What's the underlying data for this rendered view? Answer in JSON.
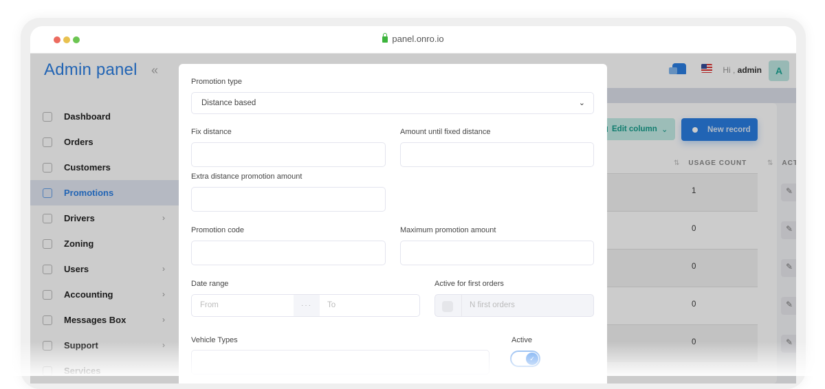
{
  "browser": {
    "url": "panel.onro.io"
  },
  "sidebar": {
    "brand": "Admin panel",
    "collapse_icon": "double-chevron-left",
    "items": [
      {
        "label": "Dashboard",
        "icon": "home-icon",
        "has_submenu": false,
        "active": false
      },
      {
        "label": "Orders",
        "icon": "orders-icon",
        "has_submenu": false,
        "active": false
      },
      {
        "label": "Customers",
        "icon": "customers-icon",
        "has_submenu": false,
        "active": false
      },
      {
        "label": "Promotions",
        "icon": "promotions-icon",
        "has_submenu": false,
        "active": true
      },
      {
        "label": "Drivers",
        "icon": "drivers-icon",
        "has_submenu": true,
        "active": false
      },
      {
        "label": "Zoning",
        "icon": "zoning-icon",
        "has_submenu": false,
        "active": false
      },
      {
        "label": "Users",
        "icon": "users-icon",
        "has_submenu": true,
        "active": false
      },
      {
        "label": "Accounting",
        "icon": "accounting-icon",
        "has_submenu": true,
        "active": false
      },
      {
        "label": "Messages Box",
        "icon": "messages-icon",
        "has_submenu": true,
        "active": false
      },
      {
        "label": "Support",
        "icon": "support-icon",
        "has_submenu": true,
        "active": false
      },
      {
        "label": "Services",
        "icon": "services-icon",
        "has_submenu": false,
        "active": false
      }
    ]
  },
  "topbar": {
    "greeting_prefix": "Hi ,",
    "username": "admin",
    "avatar_letter": "A"
  },
  "toolbar": {
    "edit_column_label": "Edit column",
    "new_record_label": "New record"
  },
  "table": {
    "columns": [
      "USAGE COUNT",
      "ACTIONS"
    ],
    "rows": [
      {
        "usage_count": "1"
      },
      {
        "usage_count": "0"
      },
      {
        "usage_count": "0"
      },
      {
        "usage_count": "0"
      },
      {
        "usage_count": "0"
      }
    ]
  },
  "modal": {
    "promotion_type_label": "Promotion type",
    "promotion_type_value": "Distance based",
    "fix_distance_label": "Fix distance",
    "fix_distance_value": "",
    "amount_until_label": "Amount until fixed distance",
    "amount_until_value": "",
    "extra_distance_label": "Extra distance promotion amount",
    "extra_distance_value": "",
    "promotion_code_label": "Promotion code",
    "promotion_code_value": "",
    "max_amount_label": "Maximum promotion amount",
    "max_amount_value": "",
    "date_range_label": "Date range",
    "date_from_placeholder": "From",
    "date_separator": "···",
    "date_to_placeholder": "To",
    "first_orders_label": "Active for first orders",
    "first_orders_placeholder": "N first orders",
    "first_orders_checked": false,
    "vehicle_types_label": "Vehicle Types",
    "active_label": "Active",
    "active_on": true
  }
}
